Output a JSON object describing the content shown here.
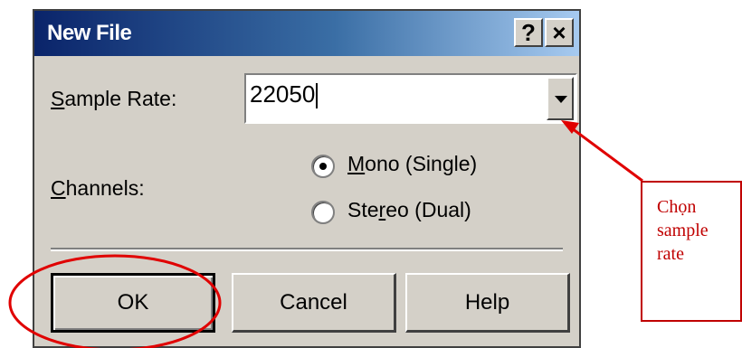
{
  "dialog": {
    "title": "New File",
    "help_button": "?",
    "close_button": "×"
  },
  "sample_rate": {
    "label_accel": "S",
    "label_rest": "ample Rate:",
    "value": "22050"
  },
  "channels": {
    "label_accel": "C",
    "label_rest": "hannels:",
    "options": [
      {
        "pre": "",
        "accel": "M",
        "post": "ono (Single)",
        "checked": true
      },
      {
        "pre": "Ste",
        "accel": "r",
        "post": "eo (Dual)",
        "checked": false
      }
    ]
  },
  "buttons": {
    "ok": "OK",
    "cancel": "Cancel",
    "help": "Help"
  },
  "annotation": {
    "text": "Chọn sample rate",
    "color": "#c00000"
  },
  "colors": {
    "dialog_bg": "#d4d0c8",
    "title_start": "#0a246a",
    "title_end": "#a6caf0"
  }
}
